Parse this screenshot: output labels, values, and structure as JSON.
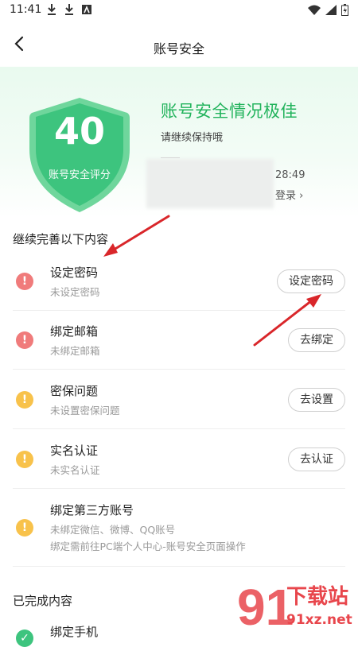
{
  "status_bar": {
    "time": "11:41"
  },
  "header": {
    "title": "账号安全"
  },
  "hero": {
    "score": "40",
    "score_label": "账号安全评分",
    "status_title": "账号安全情况极佳",
    "status_sub": "请继续保持哦",
    "login_time_fragment": "28:49",
    "login_link_fragment": "登录 ›"
  },
  "section_todo": {
    "title": "继续完善以下内容"
  },
  "items": [
    {
      "title": "设定密码",
      "sub": "未设定密码",
      "button": "设定密码",
      "level": "red"
    },
    {
      "title": "绑定邮箱",
      "sub": "未绑定邮箱",
      "button": "去绑定",
      "level": "red"
    },
    {
      "title": "密保问题",
      "sub": "未设置密保问题",
      "button": "去设置",
      "level": "yellow"
    },
    {
      "title": "实名认证",
      "sub": "未实名认证",
      "button": "去认证",
      "level": "yellow"
    },
    {
      "title": "绑定第三方账号",
      "sub": "未绑定微信、微博、QQ账号",
      "sub2": "绑定需前往PC端个人中心-账号安全页面操作",
      "level": "yellow"
    }
  ],
  "section_done": {
    "title": "已完成内容"
  },
  "done_items": [
    {
      "title": "绑定手机",
      "level": "green"
    }
  ],
  "watermark": {
    "brand": "下载站",
    "url": "91xz.net"
  },
  "colors": {
    "accent_green": "#22b35c",
    "shield_green": "#3dc47e",
    "alert_red": "#f07b7b",
    "alert_yellow": "#f8c24b",
    "arrow_red": "#d9262a"
  }
}
